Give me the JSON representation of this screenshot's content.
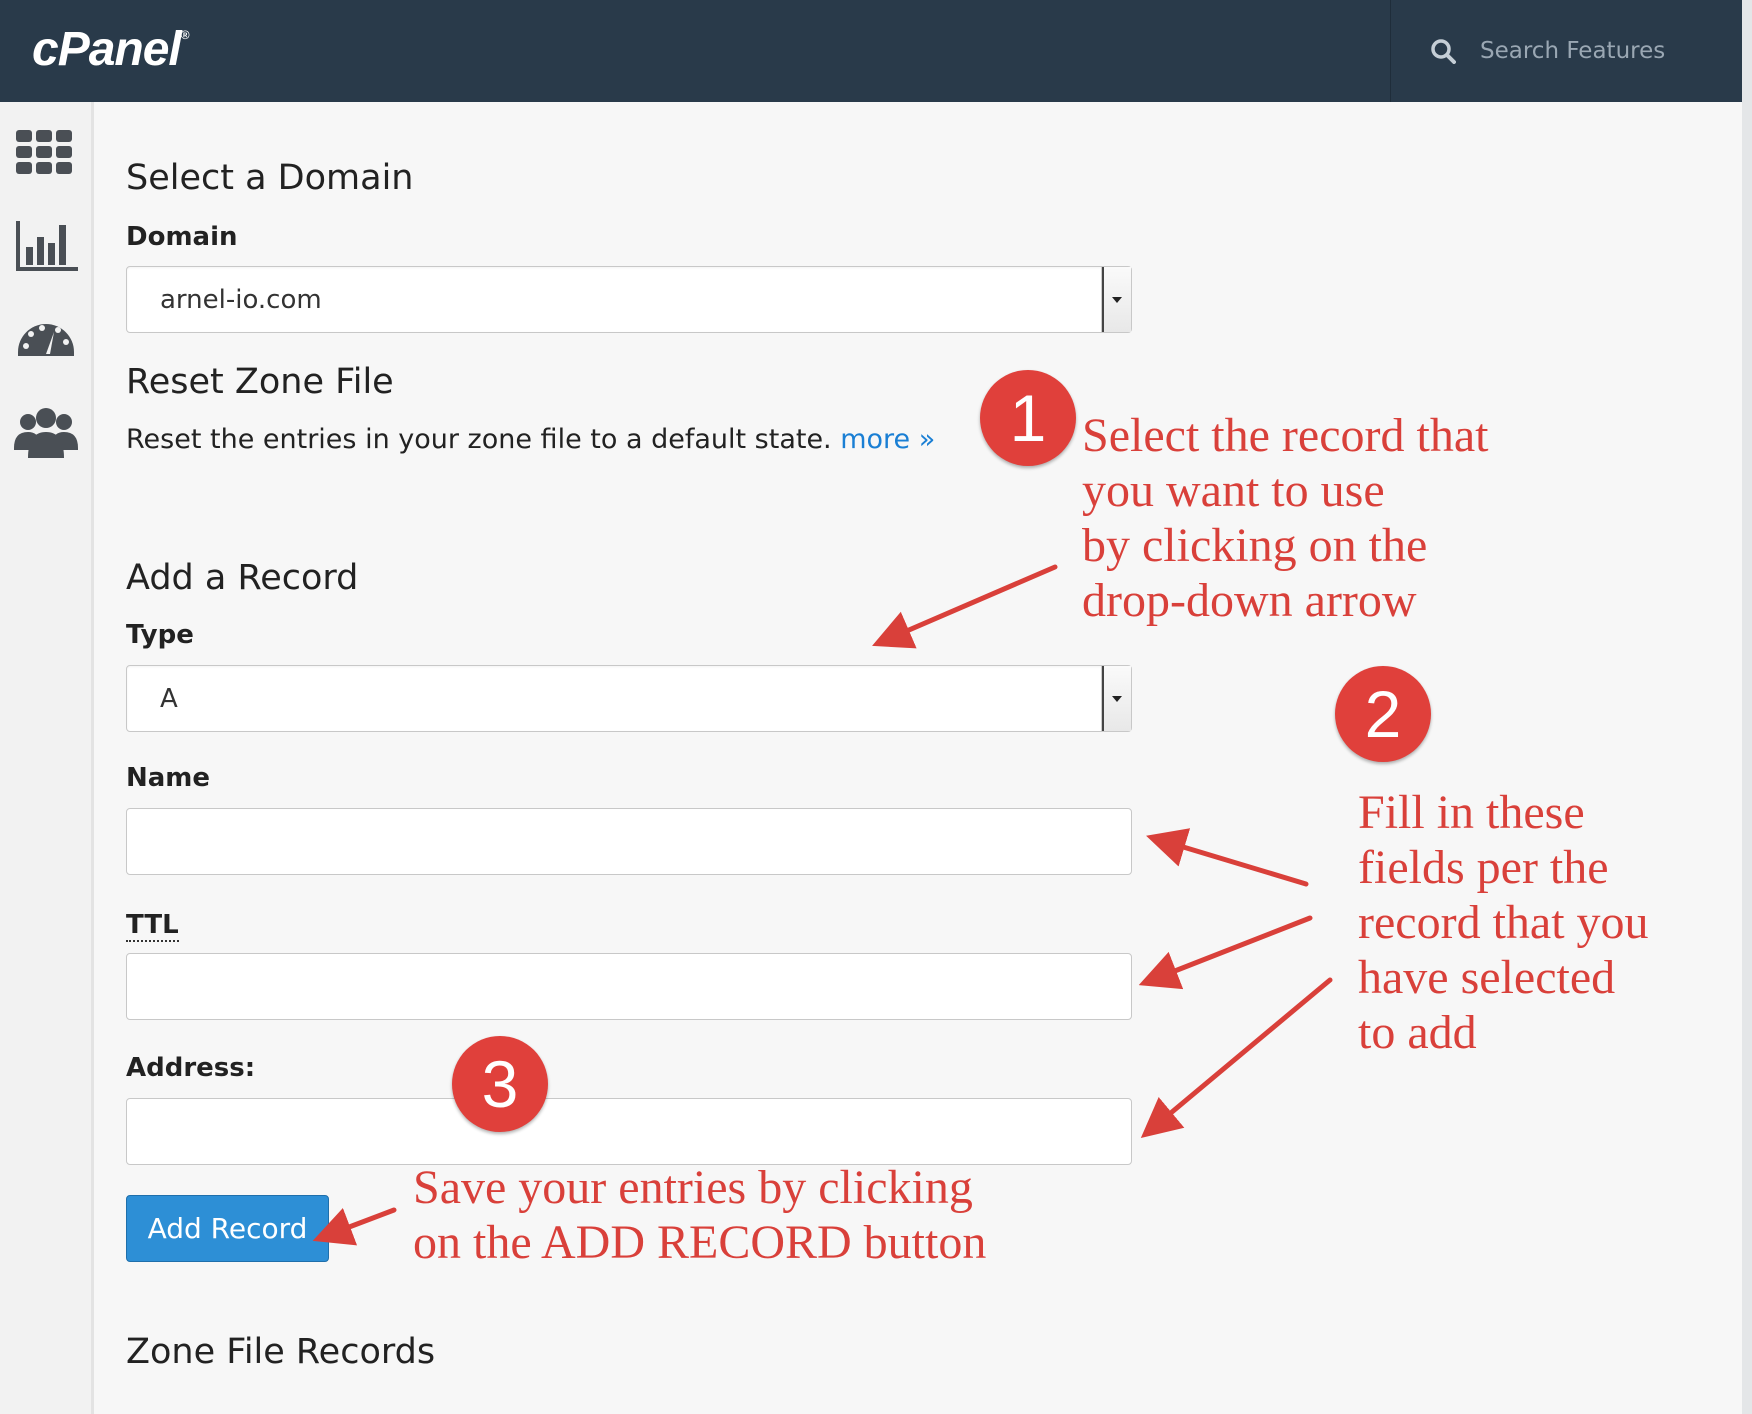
{
  "header": {
    "logo": "cPanel",
    "logo_mark": "®",
    "search_placeholder": "Search Features"
  },
  "sidebar": {
    "icons": [
      "grid-icon",
      "stats-icon",
      "dashboard-gauge-icon",
      "users-icon"
    ]
  },
  "select_domain": {
    "heading": "Select a Domain",
    "label": "Domain",
    "value": "arnel-io.com"
  },
  "reset_zone": {
    "heading": "Reset Zone File",
    "description": "Reset the entries in your zone file to a default state.",
    "more_link": "more »"
  },
  "add_record": {
    "heading": "Add a Record",
    "type_label": "Type",
    "type_value": "A",
    "name_label": "Name",
    "name_value": "",
    "ttl_label": "TTL",
    "ttl_value": "",
    "address_label": "Address:",
    "address_value": "",
    "button": "Add Record"
  },
  "zone_records": {
    "heading": "Zone File Records"
  },
  "annotations": {
    "badge1": "1",
    "badge2": "2",
    "badge3": "3",
    "note1": [
      "Select the record that",
      "you want to use",
      "by clicking on the",
      "drop-down arrow"
    ],
    "note2": [
      "Fill in these",
      "fields per the",
      "record that you",
      "have selected",
      "to add"
    ],
    "note3": [
      "Save your entries by clicking",
      "on the ADD RECORD button"
    ],
    "color": "#d9403a"
  }
}
